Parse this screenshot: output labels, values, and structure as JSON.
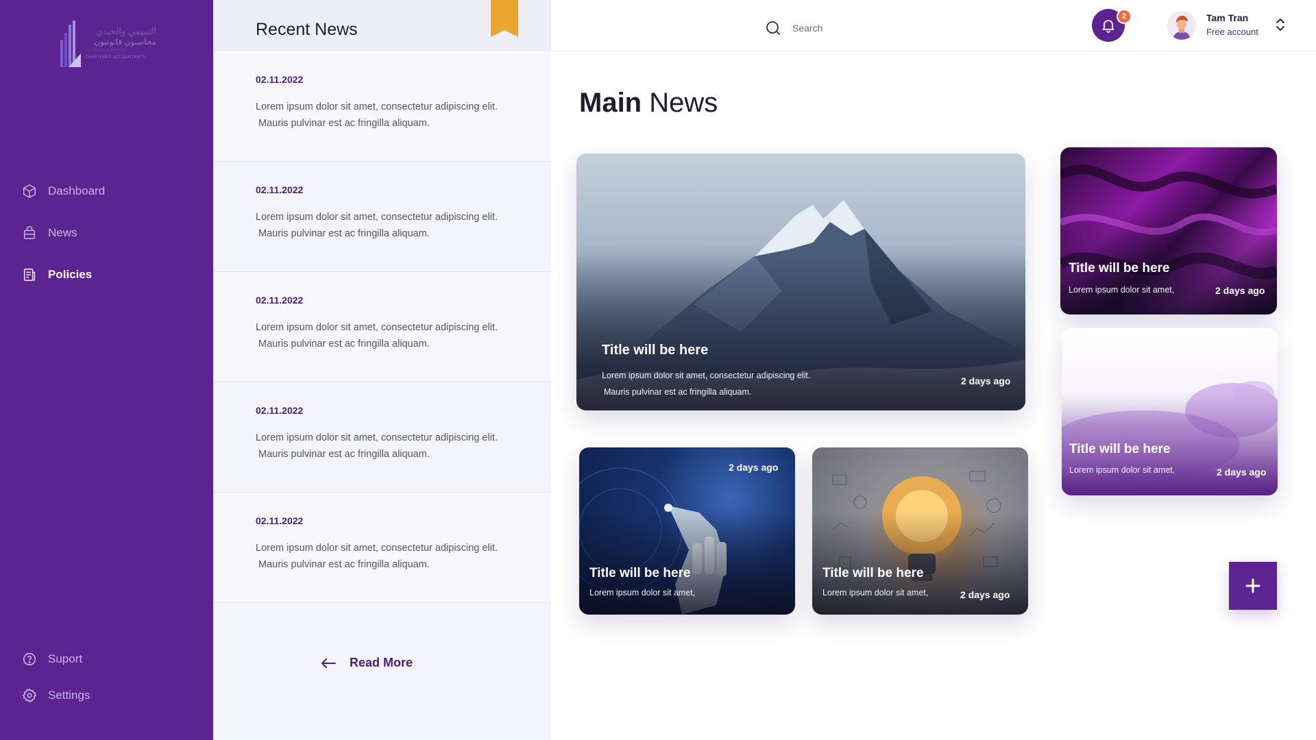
{
  "brand": {
    "logo_arabic_line1": "التميمي والحيدي",
    "logo_arabic_line2": "محاسبون قانونيون",
    "logo_english_line1": "ALTAMIMI & ALHAIDI",
    "logo_english_line2": "CHARTERED ACCOUNTANTS",
    "primary_color": "#5b2491",
    "accent_color": "#f36a3d",
    "bookmark_color": "#e8a630"
  },
  "sidebar": {
    "items": [
      {
        "label": "Dashboard",
        "icon": "cube-icon",
        "active": false
      },
      {
        "label": "News",
        "icon": "bag-icon",
        "active": false
      },
      {
        "label": "Policies",
        "icon": "document-icon",
        "active": true
      }
    ],
    "bottom_items": [
      {
        "label": "Suport",
        "icon": "help-circle-icon"
      },
      {
        "label": "Settings",
        "icon": "gear-icon"
      }
    ]
  },
  "recent": {
    "title": "Recent News",
    "items": [
      {
        "date": "02.11.2022",
        "line1": "Lorem ipsum dolor sit amet, consectetur adipiscing elit.",
        "line2": "Mauris pulvinar est ac fringilla aliquam."
      },
      {
        "date": "02.11.2022",
        "line1": "Lorem ipsum dolor sit amet, consectetur adipiscing elit.",
        "line2": "Mauris pulvinar est ac fringilla aliquam."
      },
      {
        "date": "02.11.2022",
        "line1": "Lorem ipsum dolor sit amet, consectetur adipiscing elit.",
        "line2": "Mauris pulvinar est ac fringilla aliquam."
      },
      {
        "date": "02.11.2022",
        "line1": "Lorem ipsum dolor sit amet, consectetur adipiscing elit.",
        "line2": "Mauris pulvinar est ac fringilla aliquam."
      },
      {
        "date": "02.11.2022",
        "line1": "Lorem ipsum dolor sit amet, consectetur adipiscing elit.",
        "line2": "Mauris pulvinar est ac fringilla aliquam."
      }
    ],
    "read_more": "Read More"
  },
  "topbar": {
    "search_placeholder": "Search",
    "notification_count": "2",
    "user_name": "Tam Tran",
    "user_plan": "Free account"
  },
  "main": {
    "title_bold": "Main",
    "title_rest": " News",
    "featured": {
      "title": "Title will be here",
      "line1": "Lorem ipsum dolor sit amet, consectetur adipiscing elit.",
      "line2": "Mauris pulvinar est ac fringilla aliquam.",
      "time": "2 days ago"
    },
    "cards": [
      {
        "title": "Title will be here",
        "text": "Lorem ipsum dolor sit amet,",
        "time": "2 days ago"
      },
      {
        "title": "Title will be here",
        "text": "Lorem ipsum dolor sit amet,",
        "time": "2 days ago"
      },
      {
        "title": "Title will be here",
        "text": "Lorem ipsum dolor sit amet,",
        "time": "2 days ago"
      },
      {
        "title": "Title will be here",
        "text": "Lorem ipsum dolor sit amet,",
        "time": "2 days ago"
      }
    ]
  }
}
